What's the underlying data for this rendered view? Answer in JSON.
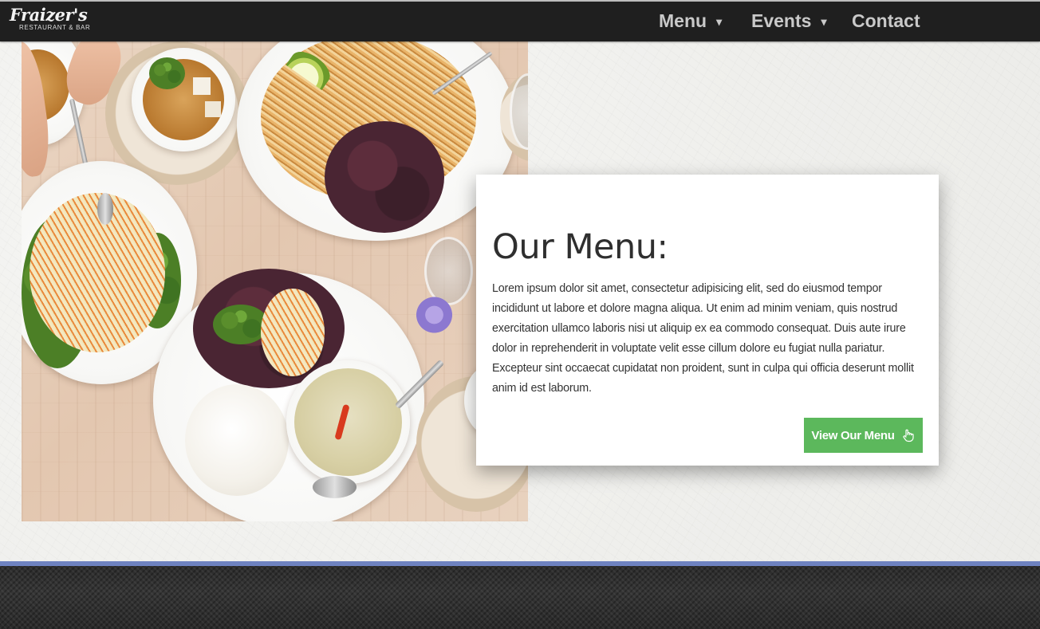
{
  "header": {
    "logo_script": "Fraizer's",
    "logo_sub": "RESTAURANT & BAR",
    "nav": [
      {
        "label": "Menu",
        "caret": "▾"
      },
      {
        "label": "Events",
        "caret": "▾"
      },
      {
        "label": "Contact"
      }
    ]
  },
  "hero_image": {
    "icon": "food-photo"
  },
  "menu_card": {
    "title": "Our Menu:",
    "body": "Lorem ipsum dolor sit amet, consectetur adipisicing elit, sed do eiusmod tempor incididunt ut labore et dolore magna aliqua. Ut enim ad minim veniam, quis nostrud exercitation ullamco laboris nisi ut aliquip ex ea commodo consequat. Duis aute irure dolor in reprehenderit in voluptate velit esse cillum dolore eu fugiat nulla pariatur. Excepteur sint occaecat cupidatat non proident, sunt in culpa qui officia deserunt mollit anim id est laborum.",
    "button_label": "View Our Menu",
    "button_icon": "pointing-hand-icon"
  },
  "colors": {
    "navbar": "#1f1f1f",
    "button": "#5cb85c",
    "footer_accent": "#6e82c0",
    "footer": "#2c2c2c"
  }
}
